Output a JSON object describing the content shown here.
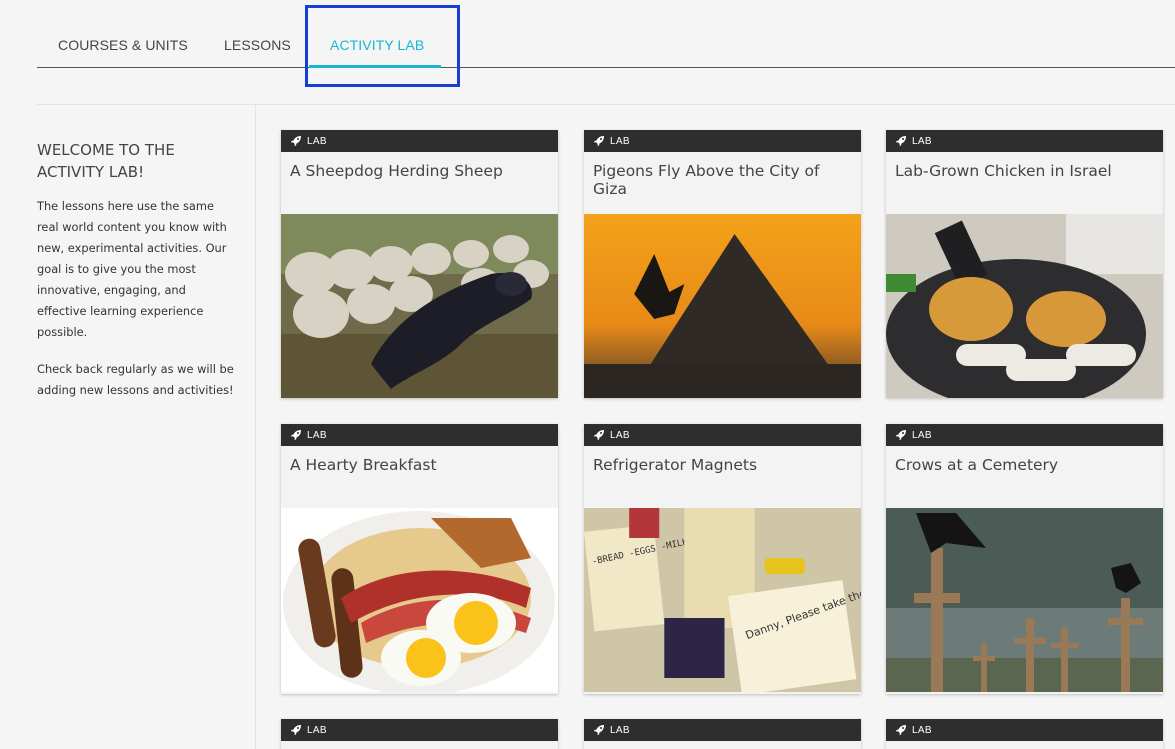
{
  "tabs": {
    "courses": "COURSES & UNITS",
    "lessons": "LESSONS",
    "activity_lab": "ACTIVITY LAB"
  },
  "accent_color": "#18b6d4",
  "sidebar": {
    "heading": "WELCOME TO THE ACTIVITY LAB!",
    "paragraph1": "The lessons here use the same real world content you know with new, experimental activities. Our goal is to give you the most innovative, engaging, and effective learning experience possible.",
    "paragraph2": "Check back regularly as we will be adding new lessons and activities!"
  },
  "cards": [
    {
      "tag": "LAB",
      "title": "A Sheepdog Herding Sheep",
      "icon": "rocket-icon"
    },
    {
      "tag": "LAB",
      "title": "Pigeons Fly Above the City of Giza",
      "icon": "rocket-icon"
    },
    {
      "tag": "LAB",
      "title": "Lab-Grown Chicken in Israel",
      "icon": "rocket-icon"
    },
    {
      "tag": "LAB",
      "title": "A Hearty Breakfast",
      "icon": "rocket-icon"
    },
    {
      "tag": "LAB",
      "title": "Refrigerator Magnets",
      "icon": "rocket-icon"
    },
    {
      "tag": "LAB",
      "title": "Crows at a Cemetery",
      "icon": "rocket-icon"
    },
    {
      "tag": "LAB",
      "icon": "rocket-icon"
    },
    {
      "tag": "LAB",
      "icon": "rocket-icon"
    },
    {
      "tag": "LAB",
      "icon": "rocket-icon"
    }
  ],
  "magnet_note": "Danny, Please take the trash out. ♡ -mom",
  "grocery_list": "-BREAD -EGGS -MILK -COFFEE"
}
